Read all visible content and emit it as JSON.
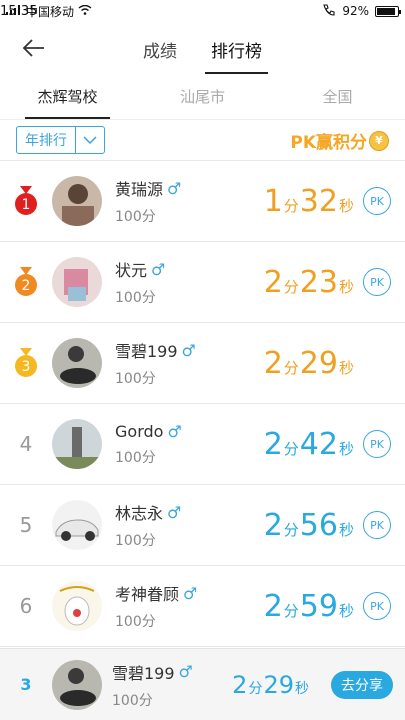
{
  "status": {
    "carrier": "中国移动",
    "time": "15:35",
    "battery": "92%",
    "battery_level": 0.92
  },
  "nav": {
    "tabs": [
      {
        "label": "成绩",
        "active": false
      },
      {
        "label": "排行榜",
        "active": true
      }
    ]
  },
  "scope_tabs": [
    "杰辉驾校",
    "汕尾市",
    "全国"
  ],
  "filter": {
    "selected": "年排行",
    "banner_text": "PK赢积分",
    "banner_coin": "¥"
  },
  "rankings": [
    {
      "rank": "1",
      "name": "黄瑞源",
      "gender": "♂",
      "score": "100分",
      "min": "1",
      "min_unit": "分",
      "sec": "32",
      "sec_unit": "秒",
      "pk": "PK",
      "style": "gold"
    },
    {
      "rank": "2",
      "name": "状元",
      "gender": "♂",
      "score": "100分",
      "min": "2",
      "min_unit": "分",
      "sec": "23",
      "sec_unit": "秒",
      "pk": "PK",
      "style": "gold"
    },
    {
      "rank": "3",
      "name": "雪碧199",
      "gender": "♂",
      "score": "100分",
      "min": "2",
      "min_unit": "分",
      "sec": "29",
      "sec_unit": "秒",
      "pk": "",
      "style": "gold"
    },
    {
      "rank": "4",
      "name": "Gordo",
      "gender": "♂",
      "score": "100分",
      "min": "2",
      "min_unit": "分",
      "sec": "42",
      "sec_unit": "秒",
      "pk": "PK",
      "style": "blue"
    },
    {
      "rank": "5",
      "name": "林志永",
      "gender": "♂",
      "score": "100分",
      "min": "2",
      "min_unit": "分",
      "sec": "56",
      "sec_unit": "秒",
      "pk": "PK",
      "style": "blue"
    },
    {
      "rank": "6",
      "name": "考神眷顾",
      "gender": "♂",
      "score": "100分",
      "min": "2",
      "min_unit": "分",
      "sec": "59",
      "sec_unit": "秒",
      "pk": "PK",
      "style": "blue"
    }
  ],
  "my_rank": {
    "rank": "3",
    "name": "雪碧199",
    "gender": "♂",
    "score": "100分",
    "min": "2",
    "min_unit": "分",
    "sec": "29",
    "sec_unit": "秒",
    "share_label": "去分享"
  },
  "colors": {
    "accent": "#2aa8e0",
    "gold": "#f0a020",
    "medal_1": "#e02020",
    "medal_2": "#f08a20",
    "medal_3": "#f5b820"
  }
}
